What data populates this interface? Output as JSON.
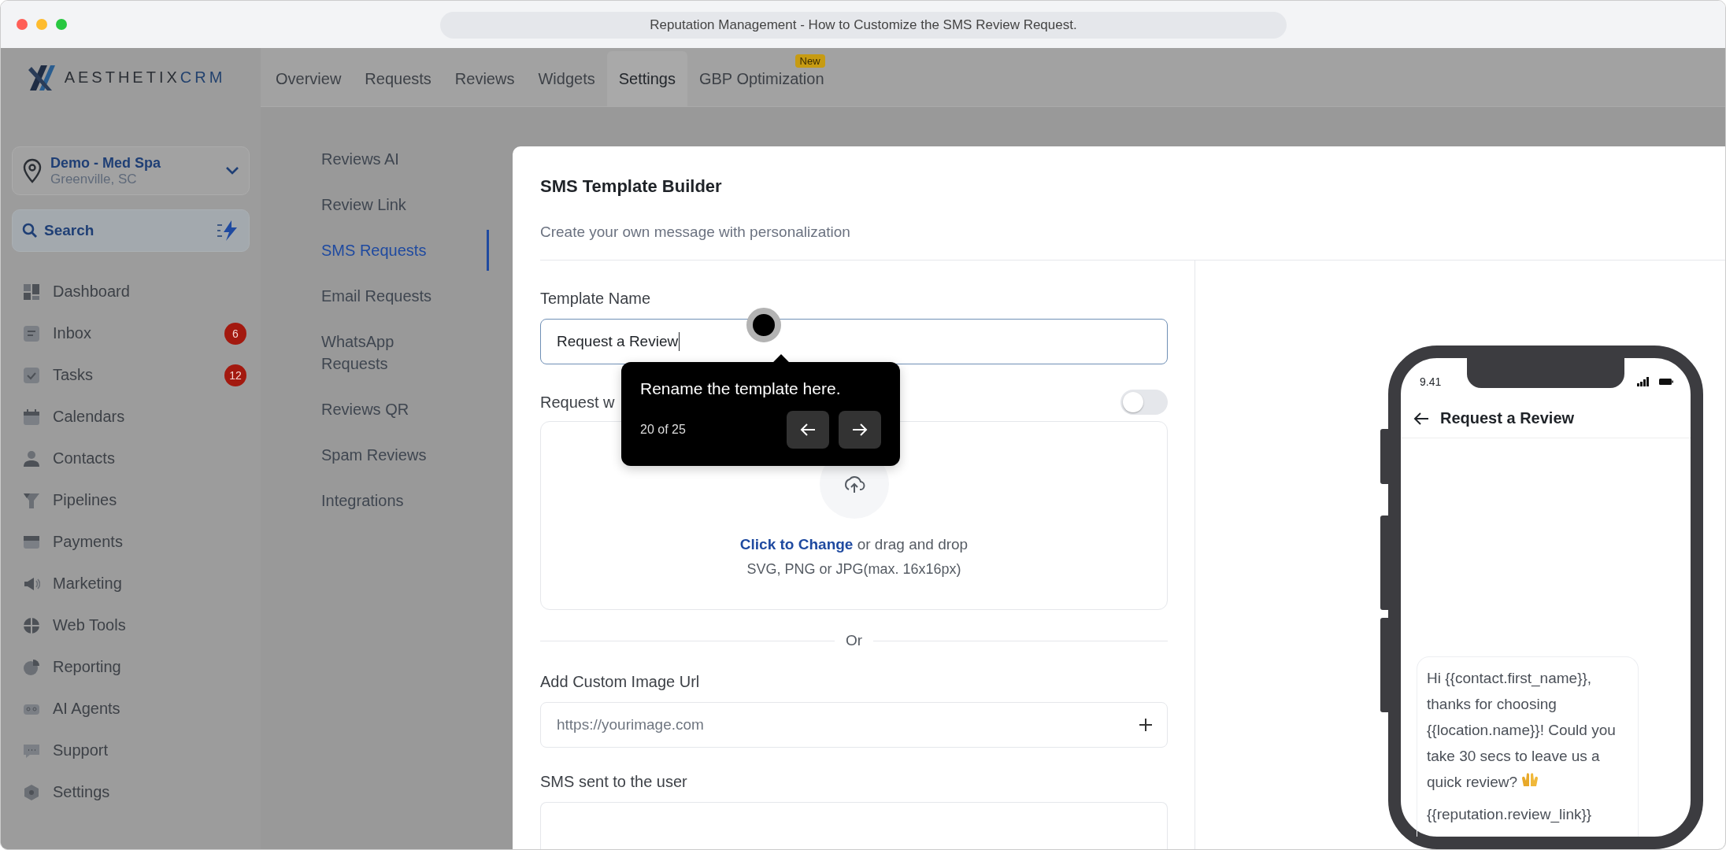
{
  "browser": {
    "title": "Reputation Management - How to Customize the SMS Review Request."
  },
  "logo": {
    "name": "AESTHETIX",
    "suffix": "CRM"
  },
  "top_tabs": [
    {
      "label": "Overview",
      "selected": false
    },
    {
      "label": "Requests",
      "selected": false
    },
    {
      "label": "Reviews",
      "selected": false
    },
    {
      "label": "Widgets",
      "selected": false
    },
    {
      "label": "Settings",
      "selected": true
    },
    {
      "label": "GBP Optimization",
      "selected": false,
      "badge": "New"
    }
  ],
  "location": {
    "name": "Demo - Med Spa",
    "address": "Greenville, SC"
  },
  "search": {
    "label": "Search"
  },
  "nav": [
    {
      "label": "Dashboard"
    },
    {
      "label": "Inbox",
      "badge": "6"
    },
    {
      "label": "Tasks",
      "badge": "12"
    },
    {
      "label": "Calendars"
    },
    {
      "label": "Contacts"
    },
    {
      "label": "Pipelines"
    },
    {
      "label": "Payments"
    },
    {
      "label": "Marketing"
    },
    {
      "label": "Web Tools"
    },
    {
      "label": "Reporting"
    },
    {
      "label": "AI Agents"
    },
    {
      "label": "Support"
    },
    {
      "label": "Settings"
    }
  ],
  "settings_menu": [
    {
      "label": "Reviews AI",
      "selected": false
    },
    {
      "label": "Review Link",
      "selected": false
    },
    {
      "label": "SMS Requests",
      "selected": true
    },
    {
      "label": "Email Requests",
      "selected": false
    },
    {
      "label": "WhatsApp Requests",
      "selected": false
    },
    {
      "label": "Reviews QR",
      "selected": false
    },
    {
      "label": "Spam Reviews",
      "selected": false
    },
    {
      "label": "Integrations",
      "selected": false
    }
  ],
  "modal": {
    "title": "SMS Template Builder",
    "subtitle": "Create your own message with personalization",
    "template_name": {
      "label": "Template Name",
      "value": "Request a Review"
    },
    "toggle": {
      "label": "Request w",
      "on": false
    },
    "upload": {
      "link": "Click to Change",
      "text": "or drag and drop",
      "hint": "SVG, PNG or JPG(max. 16x16px)"
    },
    "divider": "Or",
    "image_url": {
      "label": "Add Custom Image Url",
      "placeholder": "https://yourimage.com"
    },
    "sms": {
      "label": "SMS sent to the user"
    }
  },
  "tooltip": {
    "text": "Rename the template here.",
    "step": "20 of 25"
  },
  "phone": {
    "time": "9.41",
    "title": "Request a Review",
    "message": [
      "Hi {{contact.first_name}}, thanks for choosing {{location.name}}! Could you take 30 secs to leave us a quick review?",
      "{{reputation.review_link}}"
    ]
  }
}
